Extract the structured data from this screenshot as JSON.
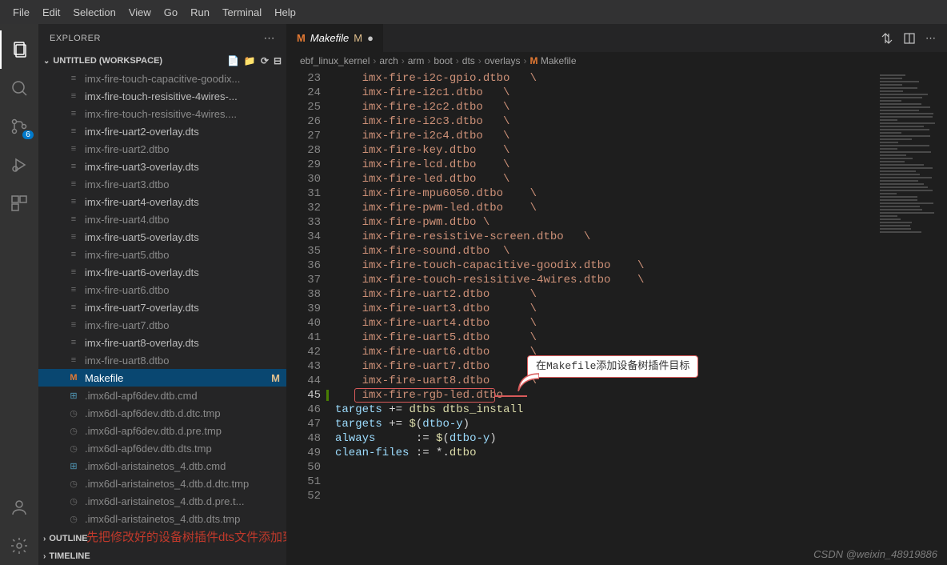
{
  "menu": [
    "File",
    "Edit",
    "Selection",
    "View",
    "Go",
    "Run",
    "Terminal",
    "Help"
  ],
  "activity": {
    "scm_badge": "6"
  },
  "sidebar": {
    "title": "EXPLORER",
    "workspace": "UNTITLED (WORKSPACE)",
    "outline": "OUTLINE",
    "timeline": "TIMELINE",
    "files": [
      {
        "label": "imx-fire-touch-capacitive-goodix...",
        "icon": "dts",
        "dim": true
      },
      {
        "label": "imx-fire-touch-resisitive-4wires-...",
        "icon": "dts",
        "dim": false
      },
      {
        "label": "imx-fire-touch-resisitive-4wires....",
        "icon": "dts",
        "dim": true
      },
      {
        "label": "imx-fire-uart2-overlay.dts",
        "icon": "dts",
        "dim": false
      },
      {
        "label": "imx-fire-uart2.dtbo",
        "icon": "dts",
        "dim": true
      },
      {
        "label": "imx-fire-uart3-overlay.dts",
        "icon": "dts",
        "dim": false
      },
      {
        "label": "imx-fire-uart3.dtbo",
        "icon": "dts",
        "dim": true
      },
      {
        "label": "imx-fire-uart4-overlay.dts",
        "icon": "dts",
        "dim": false
      },
      {
        "label": "imx-fire-uart4.dtbo",
        "icon": "dts",
        "dim": true
      },
      {
        "label": "imx-fire-uart5-overlay.dts",
        "icon": "dts",
        "dim": false
      },
      {
        "label": "imx-fire-uart5.dtbo",
        "icon": "dts",
        "dim": true
      },
      {
        "label": "imx-fire-uart6-overlay.dts",
        "icon": "dts",
        "dim": false
      },
      {
        "label": "imx-fire-uart6.dtbo",
        "icon": "dts",
        "dim": true
      },
      {
        "label": "imx-fire-uart7-overlay.dts",
        "icon": "dts",
        "dim": false
      },
      {
        "label": "imx-fire-uart7.dtbo",
        "icon": "dts",
        "dim": true
      },
      {
        "label": "imx-fire-uart8-overlay.dts",
        "icon": "dts",
        "dim": false
      },
      {
        "label": "imx-fire-uart8.dtbo",
        "icon": "dts",
        "dim": true
      },
      {
        "label": "Makefile",
        "icon": "make",
        "dim": false,
        "active": true,
        "status": "M"
      },
      {
        "label": ".imx6dl-apf6dev.dtb.cmd",
        "icon": "win",
        "dim": true
      },
      {
        "label": ".imx6dl-apf6dev.dtb.d.dtc.tmp",
        "icon": "clock",
        "dim": true
      },
      {
        "label": ".imx6dl-apf6dev.dtb.d.pre.tmp",
        "icon": "clock",
        "dim": true
      },
      {
        "label": ".imx6dl-apf6dev.dtb.dts.tmp",
        "icon": "clock",
        "dim": true
      },
      {
        "label": ".imx6dl-aristainetos_4.dtb.cmd",
        "icon": "win",
        "dim": true
      },
      {
        "label": ".imx6dl-aristainetos_4.dtb.d.dtc.tmp",
        "icon": "clock",
        "dim": true
      },
      {
        "label": ".imx6dl-aristainetos_4.dtb.d.pre.t...",
        "icon": "clock",
        "dim": true
      },
      {
        "label": ".imx6dl-aristainetos_4.dtb.dts.tmp",
        "icon": "clock",
        "dim": true
      }
    ]
  },
  "tab": {
    "label": "Makefile",
    "status": "M"
  },
  "breadcrumbs": [
    "ebf_linux_kernel",
    "arch",
    "arm",
    "boot",
    "dts",
    "overlays",
    "Makefile"
  ],
  "lines": [
    {
      "n": 23,
      "t": "    imx-fire-i2c-gpio.dtbo   \\"
    },
    {
      "n": 24,
      "t": "    imx-fire-i2c1.dtbo   \\"
    },
    {
      "n": 25,
      "t": "    imx-fire-i2c2.dtbo   \\"
    },
    {
      "n": 26,
      "t": "    imx-fire-i2c3.dtbo   \\"
    },
    {
      "n": 27,
      "t": "    imx-fire-i2c4.dtbo   \\"
    },
    {
      "n": 28,
      "t": "    imx-fire-key.dtbo    \\"
    },
    {
      "n": 29,
      "t": "    imx-fire-lcd.dtbo    \\"
    },
    {
      "n": 30,
      "t": "    imx-fire-led.dtbo    \\"
    },
    {
      "n": 31,
      "t": "    imx-fire-mpu6050.dtbo    \\"
    },
    {
      "n": 32,
      "t": "    imx-fire-pwm-led.dtbo    \\"
    },
    {
      "n": 33,
      "t": "    imx-fire-pwm.dtbo \\"
    },
    {
      "n": 34,
      "t": "    imx-fire-resistive-screen.dtbo   \\"
    },
    {
      "n": 35,
      "t": "    imx-fire-sound.dtbo  \\"
    },
    {
      "n": 36,
      "t": "    imx-fire-touch-capacitive-goodix.dtbo    \\"
    },
    {
      "n": 37,
      "t": "    imx-fire-touch-resisitive-4wires.dtbo    \\"
    },
    {
      "n": 38,
      "t": "    imx-fire-uart2.dtbo      \\"
    },
    {
      "n": 39,
      "t": "    imx-fire-uart3.dtbo      \\"
    },
    {
      "n": 40,
      "t": "    imx-fire-uart4.dtbo      \\"
    },
    {
      "n": 41,
      "t": "    imx-fire-uart5.dtbo      \\"
    },
    {
      "n": 42,
      "t": "    imx-fire-uart6.dtbo      \\"
    },
    {
      "n": 43,
      "t": "    imx-fire-uart7.dtbo      \\"
    },
    {
      "n": 44,
      "t": "    imx-fire-uart8.dtbo      \\"
    },
    {
      "n": 45,
      "t": "    imx-fire-rgb-led.dtbo",
      "hl": true
    },
    {
      "n": 46,
      "t": ""
    },
    {
      "n": 47,
      "t": "targets += dtbs dtbs_install",
      "kind": "stmt"
    },
    {
      "n": 48,
      "t": "targets += $(dtbo-y)",
      "kind": "stmt2"
    },
    {
      "n": 49,
      "t": ""
    },
    {
      "n": 50,
      "t": "always      := $(dtbo-y)",
      "kind": "stmt2"
    },
    {
      "n": 51,
      "t": "clean-files := *.dtbo",
      "kind": "stmt3"
    },
    {
      "n": 52,
      "t": ""
    }
  ],
  "callout_text": "在Makefile添加设备树插件目标",
  "bottom_note": "先把修改好的设备树插件dts文件添加到Makefile同级目录",
  "watermark": "CSDN @weixin_48919886"
}
